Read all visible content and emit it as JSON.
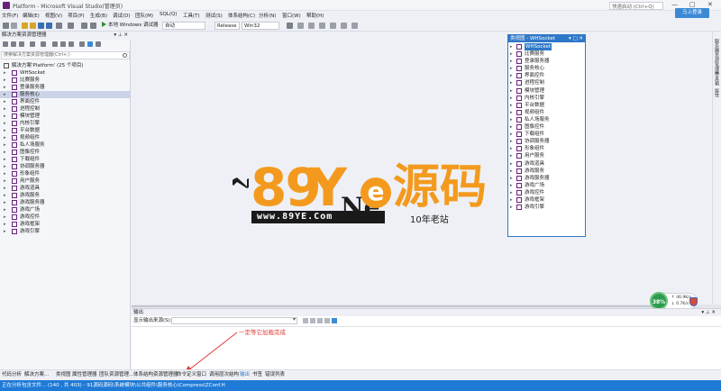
{
  "window": {
    "title": "Platform - Microsoft Visual Studio(管理员)",
    "quick_launch": "快速启动 (Ctrl+Q)",
    "controls": [
      "—",
      "□",
      "✕"
    ]
  },
  "menu": [
    "文件(F)",
    "编辑(E)",
    "视图(V)",
    "项目(P)",
    "生成(B)",
    "调试(D)",
    "团队(M)",
    "SQL(Q)",
    "工具(T)",
    "测试(S)",
    "体系结构(C)",
    "分析(N)",
    "窗口(W)",
    "帮助(H)"
  ],
  "signin": "马上登录",
  "toolbar": {
    "run_label": "本地 Windows 调试器",
    "run_mode": "自动",
    "config": "Release",
    "platform": "Win32"
  },
  "solution_explorer": {
    "title": "解决方案资源管理器",
    "search_placeholder": "搜索解决方案资源管理器(Ctrl+;)",
    "root": "解决方案'Platform' (25 个项目)",
    "items": [
      "WHSocket",
      "比赛服务",
      "登录服务器",
      "服务核心",
      "界面控件",
      "进程控制",
      "模块管理",
      "内核引擎",
      "平台数据",
      "视频组件",
      "私人场服务",
      "图像控件",
      "下载组件",
      "协调服务器",
      "形象组件",
      "用户服务",
      "游戏道具",
      "游戏服务",
      "游戏服务器",
      "游戏广场",
      "游戏控件",
      "游戏框架",
      "游戏引擎"
    ],
    "selected_index": 3
  },
  "class_view": {
    "title": "类视图 - WHSocket",
    "items": [
      "WHSocket",
      "比赛服务",
      "登录服务器",
      "服务核心",
      "界面控件",
      "进程控制",
      "模块管理",
      "内核引擎",
      "平台数据",
      "视频组件",
      "私人场服务",
      "图像控件",
      "下载组件",
      "协调服务器",
      "形象组件",
      "用户服务",
      "游戏道具",
      "游戏服务",
      "游戏服务器",
      "游戏广场",
      "游戏控件",
      "游戏框架",
      "游戏引擎"
    ]
  },
  "watermark": {
    "digits": "89",
    "letter": "Y",
    "yen": "Ne",
    "e": "e",
    "chinese": "源码",
    "url": "www.89YE.Com",
    "slogan": "10年老站"
  },
  "speed": {
    "percent": "38%",
    "up": "46.9K/s",
    "down": "0.7K/s"
  },
  "output": {
    "title": "输出",
    "source_label": "显示输出来源(S):"
  },
  "annotation": "一定等它加载完成",
  "bottom_tabs": [
    "代码分析",
    "解决方案...",
    "类视图",
    "属性管理器",
    "团队资源管理...",
    "体系结构资源管理器",
    "命令定义窗口",
    "调用层次结构",
    "输出",
    "书签",
    "错误列表"
  ],
  "active_tab_index": 8,
  "right_strip": [
    "服务器资源管理器",
    "工具箱",
    "属性"
  ],
  "status": "正在分析包含文件... (140 , 共 403) - 91源码源码\\系统模块\\公共组件\\服务核心\\Compress\\ZConf.H"
}
